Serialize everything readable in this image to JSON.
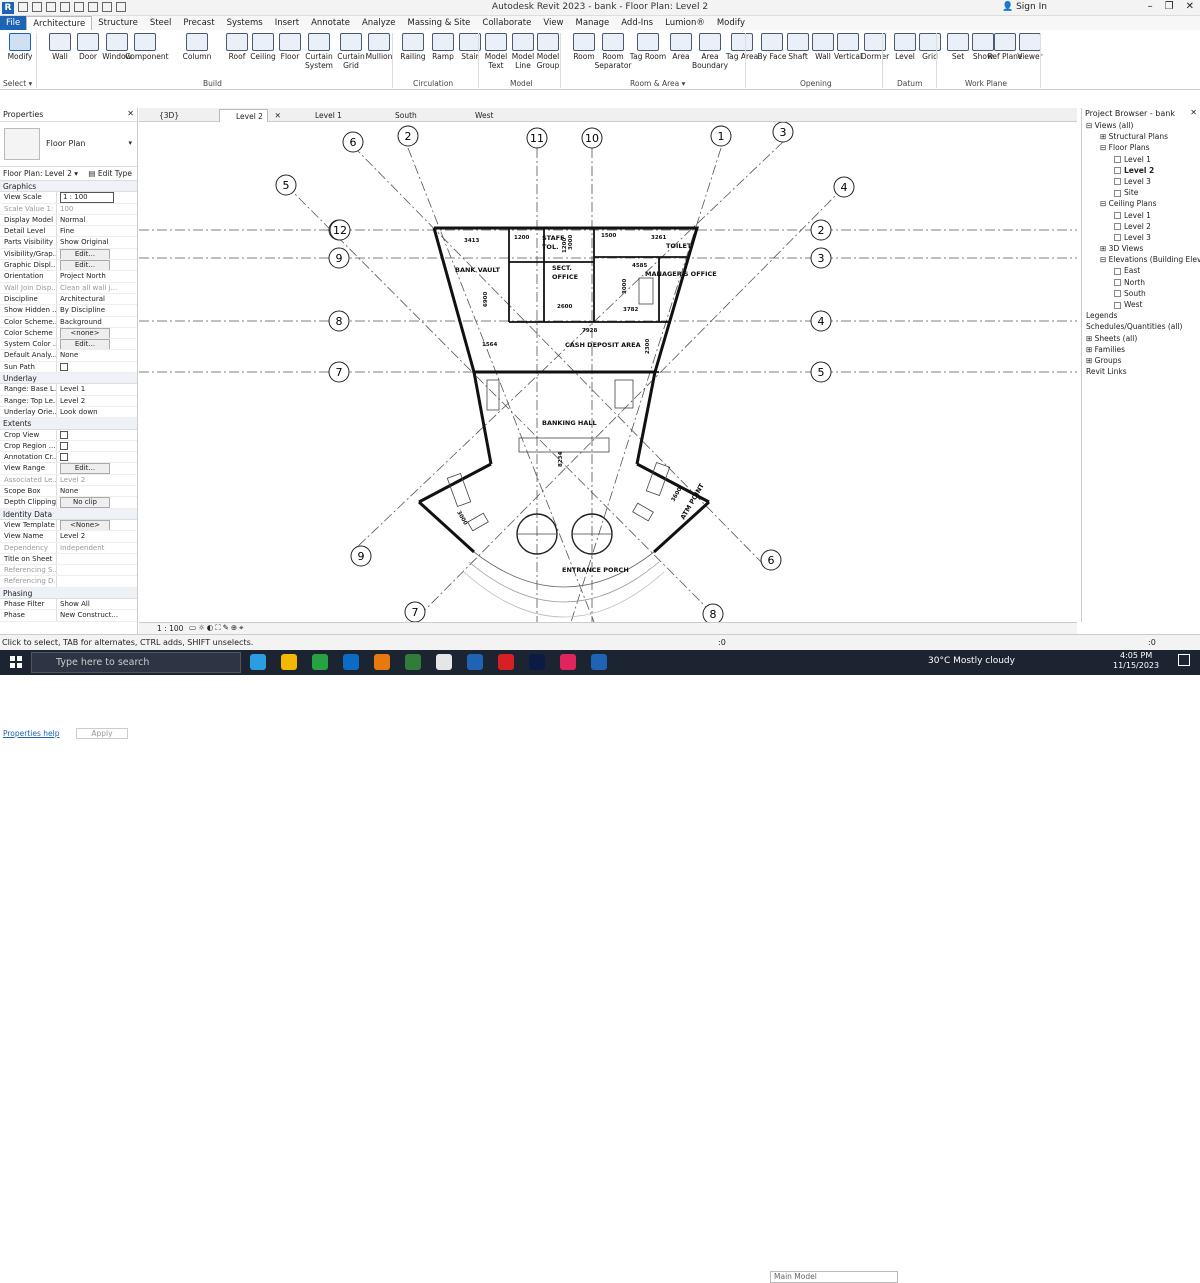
{
  "titlebar": {
    "title": "Autodesk Revit 2023 - bank - Floor Plan: Level 2",
    "signin": "Sign In"
  },
  "menu": [
    "File",
    "Architecture",
    "Structure",
    "Steel",
    "Precast",
    "Systems",
    "Insert",
    "Annotate",
    "Analyze",
    "Massing & Site",
    "Collaborate",
    "View",
    "Manage",
    "Add-Ins",
    "Lumion®",
    "Modify"
  ],
  "ribbon": {
    "buttons": [
      "Modify",
      "Wall",
      "Door",
      "Window",
      "Component",
      "Column",
      "Roof",
      "Ceiling",
      "Floor",
      "Curtain System",
      "Curtain Grid",
      "Mullion",
      "Railing",
      "Ramp",
      "Stair",
      "Model Text",
      "Model Line",
      "Model Group",
      "Room",
      "Room Separator",
      "Tag Room",
      "Area",
      "Area Boundary",
      "Tag Area",
      "By Face",
      "Shaft",
      "Wall",
      "Vertical",
      "Dormer",
      "Level",
      "Grid",
      "Set",
      "Show",
      "Ref Plane",
      "Viewer"
    ],
    "panels": [
      "Select ▾",
      "Build",
      "Circulation",
      "Model",
      "Room & Area ▾",
      "Opening",
      "Datum",
      "Work Plane"
    ]
  },
  "properties": {
    "title": "Properties",
    "type_name": "Floor Plan",
    "instance": "Floor Plan: Level 2",
    "edit_type": "Edit Type",
    "rows": [
      {
        "s": "Graphics"
      },
      {
        "k": "View Scale",
        "v": "1 : 100",
        "f": 1
      },
      {
        "k": "Scale Value 1:",
        "v": "100",
        "g": 1
      },
      {
        "k": "Display Model",
        "v": "Normal"
      },
      {
        "k": "Detail Level",
        "v": "Fine"
      },
      {
        "k": "Parts Visibility",
        "v": "Show Original"
      },
      {
        "k": "Visibility/Grap...",
        "v": "Edit...",
        "b": 1
      },
      {
        "k": "Graphic Displ...",
        "v": "Edit...",
        "b": 1
      },
      {
        "k": "Orientation",
        "v": "Project North"
      },
      {
        "k": "Wall Join Disp...",
        "v": "Clean all wall j...",
        "g": 1
      },
      {
        "k": "Discipline",
        "v": "Architectural"
      },
      {
        "k": "Show Hidden ...",
        "v": "By Discipline"
      },
      {
        "k": "Color Scheme...",
        "v": "Background"
      },
      {
        "k": "Color Scheme",
        "v": "<none>",
        "b": 1
      },
      {
        "k": "System Color ...",
        "v": "Edit...",
        "b": 1
      },
      {
        "k": "Default Analy...",
        "v": "None"
      },
      {
        "k": "Sun Path",
        "c": 1
      },
      {
        "s": "Underlay"
      },
      {
        "k": "Range: Base L...",
        "v": "Level 1"
      },
      {
        "k": "Range: Top Le...",
        "v": "Level 2"
      },
      {
        "k": "Underlay Orie...",
        "v": "Look down"
      },
      {
        "s": "Extents"
      },
      {
        "k": "Crop View",
        "c": 1
      },
      {
        "k": "Crop Region ...",
        "c": 1
      },
      {
        "k": "Annotation Cr...",
        "c": 1
      },
      {
        "k": "View Range",
        "v": "Edit...",
        "b": 1
      },
      {
        "k": "Associated Le...",
        "v": "Level 2",
        "g": 1
      },
      {
        "k": "Scope Box",
        "v": "None"
      },
      {
        "k": "Depth Clipping",
        "v": "No clip",
        "b": 1
      },
      {
        "s": "Identity Data"
      },
      {
        "k": "View Template",
        "v": "<None>",
        "b": 1
      },
      {
        "k": "View Name",
        "v": "Level 2"
      },
      {
        "k": "Dependency",
        "v": "Independent",
        "g": 1
      },
      {
        "k": "Title on Sheet",
        "v": ""
      },
      {
        "k": "Referencing S...",
        "v": "",
        "g": 1
      },
      {
        "k": "Referencing D...",
        "v": "",
        "g": 1
      },
      {
        "s": "Phasing"
      },
      {
        "k": "Phase Filter",
        "v": "Show All"
      },
      {
        "k": "Phase",
        "v": "New Construct..."
      }
    ],
    "help": "Properties help",
    "apply": "Apply"
  },
  "tabs": [
    {
      "label": "{3D}",
      "close": 0
    },
    {
      "label": "Level 2",
      "close": 1
    },
    {
      "label": "Level 1",
      "close": 0
    },
    {
      "label": "South",
      "close": 0
    },
    {
      "label": "West",
      "close": 0
    }
  ],
  "plan": {
    "grid_labels": [
      "1",
      "2",
      "3",
      "4",
      "5",
      "6",
      "7",
      "8",
      "9",
      "10",
      "11",
      "12",
      "2",
      "3",
      "4",
      "5",
      "6",
      "7",
      "8",
      "9",
      "12"
    ],
    "rooms": [
      "BANK VAULT",
      "STAFF",
      "TOL.",
      "SECT.",
      "OFFICE",
      "TOILET",
      "MANAGER'S OFFICE",
      "CASH DEPOSIT AREA",
      "BANKING HALL",
      "ENTRANCE PORCH",
      "ATM POINT"
    ],
    "dims": [
      "3413",
      "1200",
      "1500",
      "3261",
      "4585",
      "6900",
      "3000",
      "3000",
      "2600",
      "3782",
      "7928",
      "1564",
      "2300",
      "1200",
      "8234",
      "3000",
      "3600"
    ]
  },
  "view_control": {
    "scale": "1 : 100"
  },
  "browser": {
    "title": "Project Browser - bank",
    "items": [
      {
        "t": "Views (all)",
        "l": 0,
        "e": "⊟"
      },
      {
        "t": "Structural Plans",
        "l": 1,
        "e": "⊞"
      },
      {
        "t": "Floor Plans",
        "l": 1,
        "e": "⊟"
      },
      {
        "t": "Level 1",
        "l": 2,
        "b": 1
      },
      {
        "t": "Level 2",
        "l": 2,
        "b": 1,
        "sel": 1
      },
      {
        "t": "Level 3",
        "l": 2,
        "b": 1
      },
      {
        "t": "Site",
        "l": 2,
        "b": 1
      },
      {
        "t": "Ceiling Plans",
        "l": 1,
        "e": "⊟"
      },
      {
        "t": "Level 1",
        "l": 2,
        "b": 1
      },
      {
        "t": "Level 2",
        "l": 2,
        "b": 1
      },
      {
        "t": "Level 3",
        "l": 2,
        "b": 1
      },
      {
        "t": "3D Views",
        "l": 1,
        "e": "⊞"
      },
      {
        "t": "Elevations (Building Elevation)",
        "l": 1,
        "e": "⊟"
      },
      {
        "t": "East",
        "l": 2,
        "b": 1
      },
      {
        "t": "North",
        "l": 2,
        "b": 1
      },
      {
        "t": "South",
        "l": 2,
        "b": 1
      },
      {
        "t": "West",
        "l": 2,
        "b": 1
      },
      {
        "t": "Legends",
        "l": 0,
        "e": ""
      },
      {
        "t": "Schedules/Quantities (all)",
        "l": 0,
        "e": ""
      },
      {
        "t": "Sheets (all)",
        "l": 0,
        "e": "⊞"
      },
      {
        "t": "Families",
        "l": 0,
        "e": "⊞"
      },
      {
        "t": "Groups",
        "l": 0,
        "e": "⊞"
      },
      {
        "t": "Revit Links",
        "l": 0,
        "e": ""
      }
    ]
  },
  "status": {
    "message": "Click to select, TAB for alternates, CTRL adds, SHIFT unselects.",
    "main_model": "Main Model",
    "coord": ":0",
    "filter": ":0"
  },
  "taskbar": {
    "search": "Type here to search",
    "weather": "30°C  Mostly cloudy",
    "time": "4:05 PM",
    "date": "11/15/2023"
  },
  "colors": {
    "accent": "#1e63b4",
    "taskbar": "#1c2331"
  }
}
